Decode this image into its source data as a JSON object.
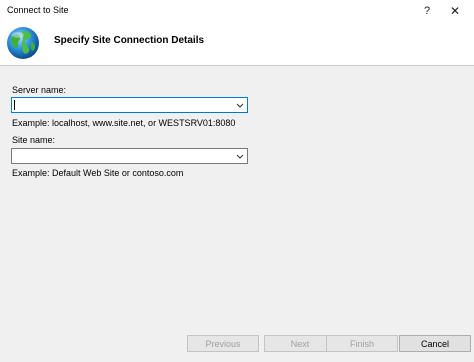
{
  "window": {
    "title": "Connect to Site",
    "help_glyph": "?",
    "close_glyph": "✕"
  },
  "header": {
    "icon": "globe-icon",
    "heading": "Specify Site Connection Details"
  },
  "form": {
    "server_label": "Server name:",
    "server_value": "",
    "server_example": "Example: localhost, www.site.net, or WESTSRV01:8080",
    "site_label": "Site name:",
    "site_value": "",
    "site_example": "Example: Default Web Site or contoso.com"
  },
  "buttons": {
    "previous": "Previous",
    "next": "Next",
    "finish": "Finish",
    "cancel": "Cancel"
  },
  "colors": {
    "focus_border": "#0078d7",
    "dialog_bg": "#f0f0f0"
  }
}
